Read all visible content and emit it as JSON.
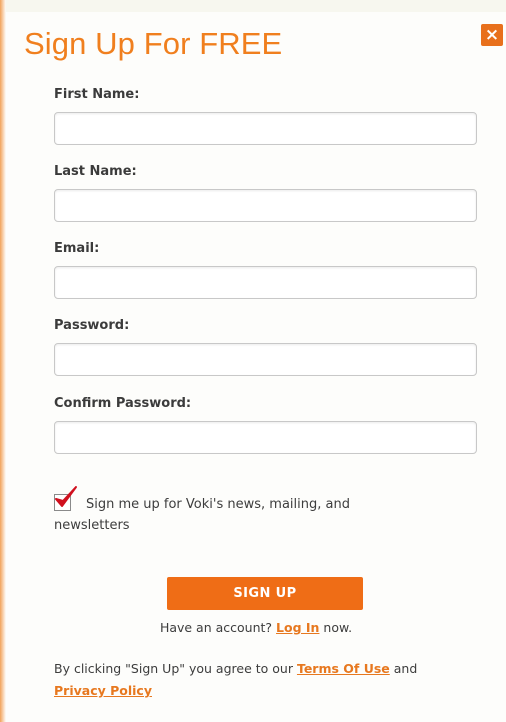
{
  "dialog": {
    "title": "Sign Up For FREE",
    "close_glyph": "×",
    "close_icon": "close-icon"
  },
  "form": {
    "fields": [
      {
        "label": "First Name:",
        "value": "",
        "placeholder": ""
      },
      {
        "label": "Last Name:",
        "value": "",
        "placeholder": ""
      },
      {
        "label": "Email:",
        "value": "",
        "placeholder": ""
      },
      {
        "label": "Password:",
        "value": "",
        "placeholder": ""
      },
      {
        "label": "Confirm Password:",
        "value": "",
        "placeholder": ""
      }
    ],
    "newsletter_checked": true,
    "newsletter_label": "Sign me up for Voki's news, mailing, and newsletters",
    "submit_label": "SIGN UP"
  },
  "login": {
    "prefix": "Have an account?",
    "link": "Log In",
    "suffix": "now."
  },
  "legal": {
    "prefix": "By clicking \"Sign Up\" you agree to our",
    "terms_link": "Terms Of Use",
    "middle": "and",
    "privacy_link": "Privacy Policy"
  },
  "colors": {
    "accent": "#f07f1e",
    "button": "#ef6d16",
    "checkmark": "#d0101e",
    "text": "#3d3d3d"
  }
}
